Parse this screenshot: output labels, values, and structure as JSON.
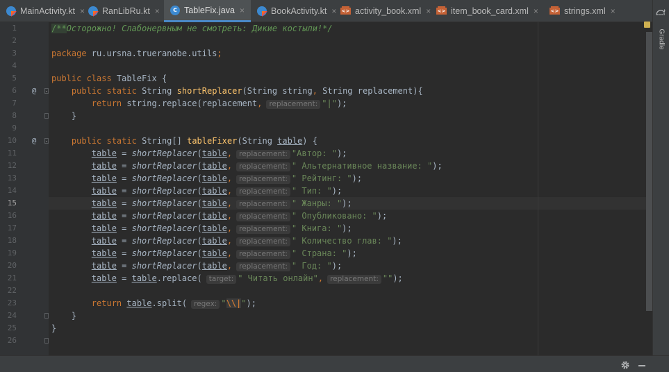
{
  "tabs": [
    {
      "label": "MainActivity.kt",
      "icon": "kotlin-file-icon",
      "active": false
    },
    {
      "label": "RanLibRu.kt",
      "icon": "kotlin-file-icon",
      "active": false
    },
    {
      "label": "TableFix.java",
      "icon": "java-class-icon",
      "active": true
    },
    {
      "label": "BookActivity.kt",
      "icon": "kotlin-file-icon",
      "active": false
    },
    {
      "label": "activity_book.xml",
      "icon": "xml-file-icon",
      "active": false
    },
    {
      "label": "item_book_card.xml",
      "icon": "xml-file-icon",
      "active": false
    },
    {
      "label": "strings.xml",
      "icon": "xml-file-icon",
      "active": false
    }
  ],
  "tab_close_glyph": "×",
  "editor": {
    "current_line": 15,
    "line_numbers": [
      "1",
      "2",
      "3",
      "4",
      "5",
      "6",
      "7",
      "8",
      "9",
      "10",
      "11",
      "12",
      "13",
      "14",
      "15",
      "16",
      "17",
      "18",
      "19",
      "20",
      "21",
      "22",
      "23",
      "24",
      "25",
      "26"
    ],
    "override_marker": "@",
    "lines": [
      [
        {
          "t": "/**",
          "c": "hl"
        },
        {
          "t": "Осторожно! Слабонервным не смотреть: Дикие костыли!*/",
          "c": "cm"
        }
      ],
      [],
      [
        {
          "t": "package ",
          "c": "kw"
        },
        {
          "t": "ru.ursna.trueranobe.utils",
          "c": "p"
        },
        {
          "t": ";",
          "c": "kw"
        }
      ],
      [],
      [
        {
          "t": "public class ",
          "c": "kw"
        },
        {
          "t": "TableFix {",
          "c": "p"
        }
      ],
      [
        {
          "t": "    "
        },
        {
          "t": "public static ",
          "c": "kw"
        },
        {
          "t": "String ",
          "c": "p"
        },
        {
          "t": "shortReplacer",
          "c": "fn"
        },
        {
          "t": "(String string",
          "c": "p"
        },
        {
          "t": ", ",
          "c": "kw"
        },
        {
          "t": "String replacement){",
          "c": "p"
        }
      ],
      [
        {
          "t": "        "
        },
        {
          "t": "return ",
          "c": "kw"
        },
        {
          "t": "string.replace(replacement",
          "c": "p"
        },
        {
          "t": ",",
          "c": "kw"
        },
        {
          "t": "replacement:",
          "c": "hint"
        },
        {
          "t": "\"|\"",
          "c": "st"
        },
        {
          "t": ");",
          "c": "p"
        }
      ],
      [
        {
          "t": "    }",
          "c": "p"
        }
      ],
      [],
      [
        {
          "t": "    "
        },
        {
          "t": "public static ",
          "c": "kw"
        },
        {
          "t": "String[] ",
          "c": "p"
        },
        {
          "t": "tableFixer",
          "c": "fn"
        },
        {
          "t": "(String ",
          "c": "p"
        },
        {
          "t": "table",
          "c": "ul"
        },
        {
          "t": ") {",
          "c": "p"
        }
      ],
      [
        {
          "t": "        "
        },
        {
          "t": "table",
          "c": "ul"
        },
        {
          "t": " = ",
          "c": "p"
        },
        {
          "t": "shortReplacer",
          "c": "it"
        },
        {
          "t": "(",
          "c": "p"
        },
        {
          "t": "table",
          "c": "ul"
        },
        {
          "t": ",",
          "c": "kw"
        },
        {
          "t": "replacement:",
          "c": "hint"
        },
        {
          "t": "\"Автор: \"",
          "c": "st"
        },
        {
          "t": ");",
          "c": "p"
        }
      ],
      [
        {
          "t": "        "
        },
        {
          "t": "table",
          "c": "ul"
        },
        {
          "t": " = ",
          "c": "p"
        },
        {
          "t": "shortReplacer",
          "c": "it"
        },
        {
          "t": "(",
          "c": "p"
        },
        {
          "t": "table",
          "c": "ul"
        },
        {
          "t": ",",
          "c": "kw"
        },
        {
          "t": "replacement:",
          "c": "hint"
        },
        {
          "t": "\" Альтернативное название: \"",
          "c": "st"
        },
        {
          "t": ");",
          "c": "p"
        }
      ],
      [
        {
          "t": "        "
        },
        {
          "t": "table",
          "c": "ul"
        },
        {
          "t": " = ",
          "c": "p"
        },
        {
          "t": "shortReplacer",
          "c": "it"
        },
        {
          "t": "(",
          "c": "p"
        },
        {
          "t": "table",
          "c": "ul"
        },
        {
          "t": ",",
          "c": "kw"
        },
        {
          "t": "replacement:",
          "c": "hint"
        },
        {
          "t": "\" Рейтинг: \"",
          "c": "st"
        },
        {
          "t": ");",
          "c": "p"
        }
      ],
      [
        {
          "t": "        "
        },
        {
          "t": "table",
          "c": "ul"
        },
        {
          "t": " = ",
          "c": "p"
        },
        {
          "t": "shortReplacer",
          "c": "it"
        },
        {
          "t": "(",
          "c": "p"
        },
        {
          "t": "table",
          "c": "ul"
        },
        {
          "t": ",",
          "c": "kw"
        },
        {
          "t": "replacement:",
          "c": "hint"
        },
        {
          "t": "\" Тип: \"",
          "c": "st"
        },
        {
          "t": ");",
          "c": "p"
        }
      ],
      [
        {
          "t": "        "
        },
        {
          "t": "table",
          "c": "ul"
        },
        {
          "t": " = ",
          "c": "p"
        },
        {
          "t": "shortReplacer",
          "c": "it"
        },
        {
          "t": "(",
          "c": "p"
        },
        {
          "t": "table",
          "c": "ul"
        },
        {
          "t": ",",
          "c": "kw"
        },
        {
          "t": "replacement:",
          "c": "hint"
        },
        {
          "t": "\" Жанры: \"",
          "c": "st"
        },
        {
          "t": ");",
          "c": "p"
        }
      ],
      [
        {
          "t": "        "
        },
        {
          "t": "table",
          "c": "ul"
        },
        {
          "t": " = ",
          "c": "p"
        },
        {
          "t": "shortReplacer",
          "c": "it"
        },
        {
          "t": "(",
          "c": "p"
        },
        {
          "t": "table",
          "c": "ul"
        },
        {
          "t": ",",
          "c": "kw"
        },
        {
          "t": "replacement:",
          "c": "hint"
        },
        {
          "t": "\" Опубликовано: \"",
          "c": "st"
        },
        {
          "t": ");",
          "c": "p"
        }
      ],
      [
        {
          "t": "        "
        },
        {
          "t": "table",
          "c": "ul"
        },
        {
          "t": " = ",
          "c": "p"
        },
        {
          "t": "shortReplacer",
          "c": "it"
        },
        {
          "t": "(",
          "c": "p"
        },
        {
          "t": "table",
          "c": "ul"
        },
        {
          "t": ",",
          "c": "kw"
        },
        {
          "t": "replacement:",
          "c": "hint"
        },
        {
          "t": "\" Книга: \"",
          "c": "st"
        },
        {
          "t": ");",
          "c": "p"
        }
      ],
      [
        {
          "t": "        "
        },
        {
          "t": "table",
          "c": "ul"
        },
        {
          "t": " = ",
          "c": "p"
        },
        {
          "t": "shortReplacer",
          "c": "it"
        },
        {
          "t": "(",
          "c": "p"
        },
        {
          "t": "table",
          "c": "ul"
        },
        {
          "t": ",",
          "c": "kw"
        },
        {
          "t": "replacement:",
          "c": "hint"
        },
        {
          "t": "\" Количество глав: \"",
          "c": "st"
        },
        {
          "t": ");",
          "c": "p"
        }
      ],
      [
        {
          "t": "        "
        },
        {
          "t": "table",
          "c": "ul"
        },
        {
          "t": " = ",
          "c": "p"
        },
        {
          "t": "shortReplacer",
          "c": "it"
        },
        {
          "t": "(",
          "c": "p"
        },
        {
          "t": "table",
          "c": "ul"
        },
        {
          "t": ",",
          "c": "kw"
        },
        {
          "t": "replacement:",
          "c": "hint"
        },
        {
          "t": "\" Страна: \"",
          "c": "st"
        },
        {
          "t": ");",
          "c": "p"
        }
      ],
      [
        {
          "t": "        "
        },
        {
          "t": "table",
          "c": "ul"
        },
        {
          "t": " = ",
          "c": "p"
        },
        {
          "t": "shortReplacer",
          "c": "it"
        },
        {
          "t": "(",
          "c": "p"
        },
        {
          "t": "table",
          "c": "ul"
        },
        {
          "t": ",",
          "c": "kw"
        },
        {
          "t": "replacement:",
          "c": "hint"
        },
        {
          "t": "\" Год: \"",
          "c": "st"
        },
        {
          "t": ");",
          "c": "p"
        }
      ],
      [
        {
          "t": "        "
        },
        {
          "t": "table",
          "c": "ul"
        },
        {
          "t": " = ",
          "c": "p"
        },
        {
          "t": "table",
          "c": "ul"
        },
        {
          "t": ".replace(",
          "c": "p"
        },
        {
          "t": "target:",
          "c": "hint"
        },
        {
          "t": "\" Читать онлайн\"",
          "c": "st"
        },
        {
          "t": ",",
          "c": "kw"
        },
        {
          "t": "replacement:",
          "c": "hint"
        },
        {
          "t": "\"\"",
          "c": "st"
        },
        {
          "t": ");",
          "c": "p"
        }
      ],
      [],
      [
        {
          "t": "        "
        },
        {
          "t": "return ",
          "c": "kw"
        },
        {
          "t": "table",
          "c": "ul"
        },
        {
          "t": ".split(",
          "c": "p"
        },
        {
          "t": "regex:",
          "c": "hint"
        },
        {
          "t": "\"",
          "c": "st"
        },
        {
          "t": "\\\\|",
          "c": "esc"
        },
        {
          "t": "\"",
          "c": "st"
        },
        {
          "t": ");",
          "c": "p"
        }
      ],
      [
        {
          "t": "    }",
          "c": "p"
        }
      ],
      [
        {
          "t": "}",
          "c": "p"
        }
      ],
      []
    ]
  },
  "gradle_label": "Gradle",
  "colors": {
    "keyword": "#cc7832",
    "method_declaration": "#ffc66d",
    "string": "#6a8759",
    "doc_comment": "#629755",
    "plain": "#a9b7c6",
    "background": "#2b2b2b",
    "active_tab_underline": "#4a88c7"
  }
}
